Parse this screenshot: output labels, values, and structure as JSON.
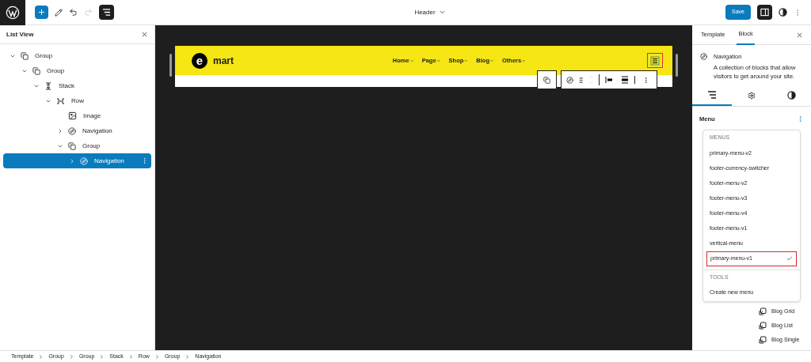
{
  "top_bar": {
    "document_title": "Header",
    "save_label": "Save"
  },
  "list_view": {
    "title": "List View",
    "items": [
      {
        "label": "Group",
        "kind": "group",
        "expanded": true,
        "selected": false,
        "children": [
          {
            "label": "Group",
            "kind": "group",
            "expanded": true,
            "selected": false,
            "children": [
              {
                "label": "Stack",
                "kind": "stack",
                "expanded": true,
                "selected": false,
                "children": [
                  {
                    "label": "Row",
                    "kind": "row",
                    "expanded": true,
                    "selected": false,
                    "children": [
                      {
                        "label": "Image",
                        "kind": "image",
                        "selected": false
                      },
                      {
                        "label": "Navigation",
                        "kind": "navigation",
                        "expanded": false,
                        "selected": false
                      },
                      {
                        "label": "Group",
                        "kind": "group",
                        "expanded": true,
                        "selected": false,
                        "children": [
                          {
                            "label": "Navigation",
                            "kind": "navigation",
                            "expanded": false,
                            "selected": true
                          }
                        ]
                      }
                    ]
                  }
                ]
              }
            ]
          }
        ]
      }
    ]
  },
  "canvas": {
    "logo_letter": "e",
    "logo_text": "mart",
    "nav_links": [
      "Home",
      "Page",
      "Shop",
      "Blog",
      "Others"
    ]
  },
  "sidebar": {
    "tabs": [
      {
        "label": "Template",
        "selected": false
      },
      {
        "label": "Block",
        "selected": true
      }
    ],
    "block": {
      "title": "Navigation",
      "description": "A collection of blocks that allow visitors to get around your site."
    },
    "sub_tabs": [
      {
        "kind": "list",
        "selected": true
      },
      {
        "kind": "settings",
        "selected": false
      },
      {
        "kind": "styles",
        "selected": false
      }
    ],
    "menu_label": "Menu",
    "dropdown": {
      "menus_heading": "MENUS",
      "menus": [
        {
          "label": "primary-menu-v2",
          "selected": false
        },
        {
          "label": "footer-currency-switcher",
          "selected": false
        },
        {
          "label": "footer-menu-v2",
          "selected": false
        },
        {
          "label": "footer-menu-v3",
          "selected": false
        },
        {
          "label": "footer-menu-v4",
          "selected": false
        },
        {
          "label": "footer-menu-v1",
          "selected": false
        },
        {
          "label": "vertical-menu",
          "selected": false
        },
        {
          "label": "primary-menu-v1",
          "selected": true
        }
      ],
      "tools_heading": "TOOLS",
      "tools": [
        "Create new menu"
      ]
    },
    "template_parts": [
      "Blog Grid",
      "Blog List",
      "Blog Single"
    ]
  },
  "breadcrumbs": [
    "Template",
    "Group",
    "Group",
    "Stack",
    "Row",
    "Group",
    "Navigation"
  ]
}
